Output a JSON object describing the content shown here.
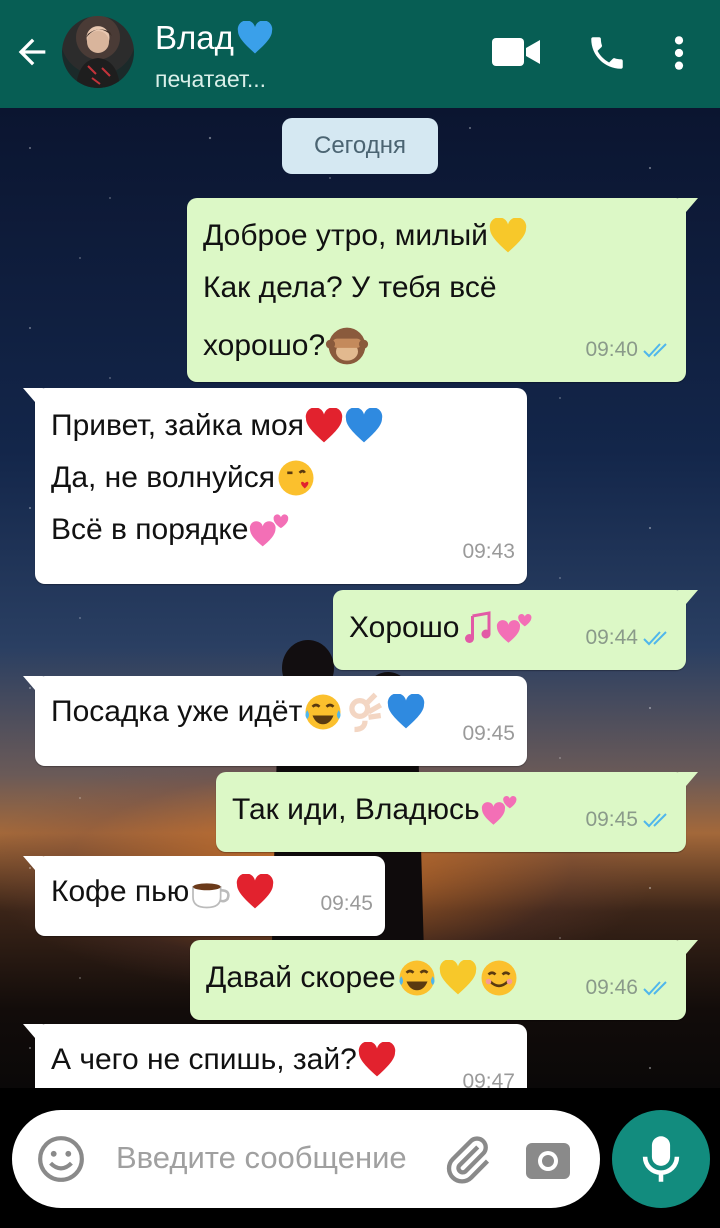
{
  "header": {
    "contact_name": "Влад",
    "status": "печатает...",
    "colors": {
      "bar": "#075e54",
      "accent": "#128c7e"
    },
    "icons": [
      "back-arrow-icon",
      "video-call-icon",
      "phone-icon",
      "more-vert-icon"
    ]
  },
  "chat": {
    "date_label": "Сегодня",
    "messages": [
      {
        "dir": "out",
        "lines": [
          "Доброе утро, милый",
          "Как дела? У тебя всё",
          "хорошо?"
        ],
        "time": "09:40"
      },
      {
        "dir": "in",
        "lines": [
          "Привет, зайка моя",
          "Да, не волнуйся",
          "Всё в порядке"
        ],
        "time": "09:43"
      },
      {
        "dir": "out",
        "lines": [
          "Хорошо"
        ],
        "time": "09:44"
      },
      {
        "dir": "in",
        "lines": [
          "Посадка уже идёт"
        ],
        "time": "09:45"
      },
      {
        "dir": "out",
        "lines": [
          "Так иди, Владюсь"
        ],
        "time": "09:45"
      },
      {
        "dir": "in",
        "lines": [
          "Кофе пью"
        ],
        "time": "09:45"
      },
      {
        "dir": "out",
        "lines": [
          "Давай скорее"
        ],
        "time": "09:46"
      },
      {
        "dir": "in",
        "lines": [
          "А чего не спишь, зай?"
        ],
        "time": "09:47"
      }
    ]
  },
  "composer": {
    "placeholder": "Введите сообщение",
    "icons": [
      "emoji-icon",
      "attach-icon",
      "camera-icon",
      "mic-icon"
    ]
  }
}
